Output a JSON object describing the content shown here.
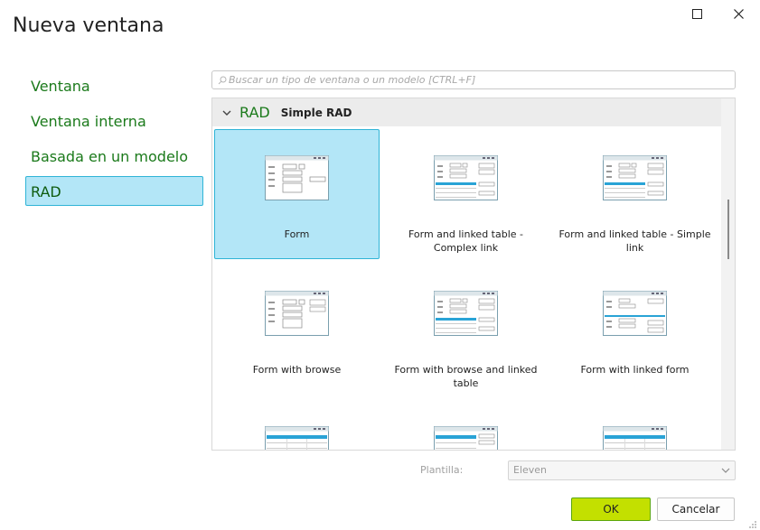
{
  "window": {
    "title": "Nueva ventana"
  },
  "sidebar": {
    "items": [
      {
        "label": "Ventana",
        "selected": false
      },
      {
        "label": "Ventana interna",
        "selected": false
      },
      {
        "label": "Basada en un modelo",
        "selected": false
      },
      {
        "label": "RAD",
        "selected": true
      }
    ]
  },
  "search": {
    "placeholder": "Buscar un tipo de ventana o un modelo [CTRL+F]",
    "value": "",
    "icon": "search-icon"
  },
  "gallery": {
    "group": {
      "name": "RAD",
      "subtitle": "Simple RAD",
      "expanded": true
    },
    "tiles": [
      {
        "label": "Form",
        "selected": true,
        "thumb": "form"
      },
      {
        "label": "Form and linked table - Complex link",
        "selected": false,
        "thumb": "table"
      },
      {
        "label": "Form and linked table - Simple link",
        "selected": false,
        "thumb": "table"
      },
      {
        "label": "Form with browse",
        "selected": false,
        "thumb": "browse"
      },
      {
        "label": "Form with browse and linked table",
        "selected": false,
        "thumb": "browse-table"
      },
      {
        "label": "Form with linked form",
        "selected": false,
        "thumb": "linked-form"
      },
      {
        "label": "",
        "selected": false,
        "thumb": "list"
      },
      {
        "label": "",
        "selected": false,
        "thumb": "list"
      },
      {
        "label": "",
        "selected": false,
        "thumb": "list"
      }
    ]
  },
  "template": {
    "label": "Plantilla:",
    "selected": "Eleven"
  },
  "buttons": {
    "ok": "OK",
    "cancel": "Cancelar"
  },
  "colors": {
    "accent_green_text": "#1b7a1b",
    "selection_fill": "#b3e6f7",
    "selection_border": "#2fb4d6",
    "ok_button": "#c3e000",
    "thumb_blue": "#29a3d6"
  }
}
